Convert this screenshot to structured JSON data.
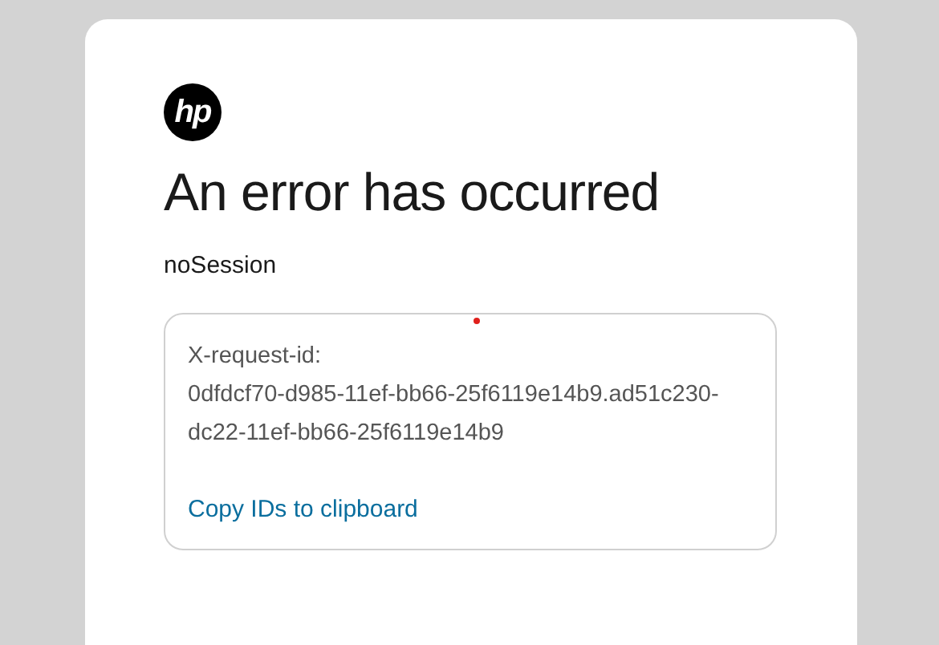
{
  "logo": {
    "text": "hp"
  },
  "title": "An error has occurred",
  "message": "noSession",
  "details": {
    "label": "X-request-id:",
    "value": "0dfdcf70-d985-11ef-bb66-25f6119e14b9.ad51c230-dc22-11ef-bb66-25f6119e14b9",
    "link": "Copy IDs to clipboard"
  }
}
